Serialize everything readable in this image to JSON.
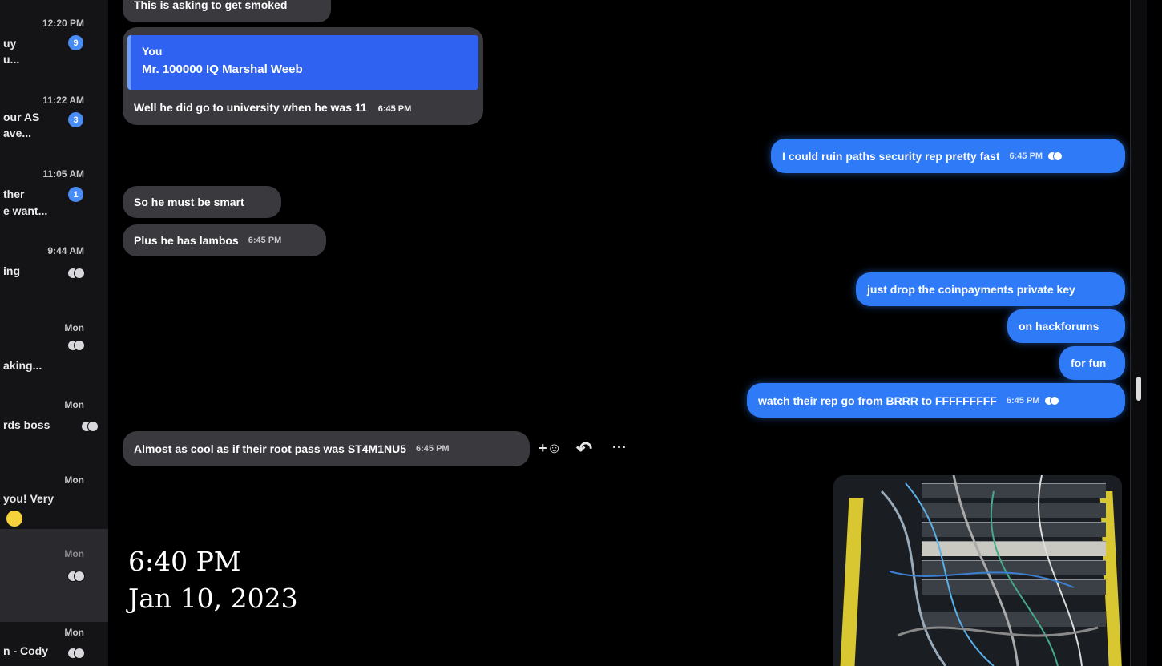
{
  "sidebar": {
    "chats": [
      {
        "time": "12:20 PM",
        "preview": [
          "uy",
          "u..."
        ],
        "badge": "9"
      },
      {
        "time": "11:22 AM",
        "preview": [
          "our AS",
          "ave..."
        ],
        "badge": "3"
      },
      {
        "time": "11:05 AM",
        "preview": [
          "ther",
          "e want..."
        ],
        "badge": "1"
      },
      {
        "time": "9:44 AM",
        "preview": [
          "ing",
          ""
        ],
        "badge": ""
      },
      {
        "time": "Mon",
        "preview": [
          "",
          "aking..."
        ],
        "badge": ""
      },
      {
        "time": "Mon",
        "preview": [
          "rds boss",
          ""
        ],
        "badge": ""
      },
      {
        "time": "Mon",
        "preview": [
          "",
          "you! Very"
        ],
        "badge": ""
      },
      {
        "time": "Mon",
        "preview": [
          "",
          ""
        ],
        "badge": ""
      },
      {
        "time": "Mon",
        "preview": [
          "n - Cody",
          ""
        ],
        "badge": ""
      }
    ]
  },
  "messages": {
    "top_cut": "This is asking to get smoked",
    "quote": {
      "author": "You",
      "text": "Mr. 100000 IQ Marshal Weeb",
      "reply": "Well he did go to university when he was 11",
      "time": "6:45 PM"
    },
    "out1": {
      "text": "I could ruin paths security rep pretty fast",
      "time": "6:45 PM"
    },
    "in1": {
      "text": "So he must be smart"
    },
    "in2": {
      "text": "Plus he has lambos",
      "time": "6:45 PM"
    },
    "out2": {
      "text": "just drop the coinpayments private key"
    },
    "out3": {
      "text": "on hackforums"
    },
    "out4": {
      "text": "for fun"
    },
    "out5": {
      "text": "watch their rep go from BRRR to FFFFFFFFF",
      "time": "6:45 PM"
    },
    "in3": {
      "text": "Almost as cool as if their root pass was ST4M1NU5",
      "time": "6:45 PM"
    }
  },
  "actions": {
    "react": "+☺",
    "reply": "↶",
    "more": "···"
  },
  "overlay": {
    "time": "6:40 PM",
    "date": "Jan 10, 2023"
  },
  "colors": {
    "outgoing": "#2f7af7",
    "incoming": "#3a3a3e",
    "background": "#000000"
  }
}
